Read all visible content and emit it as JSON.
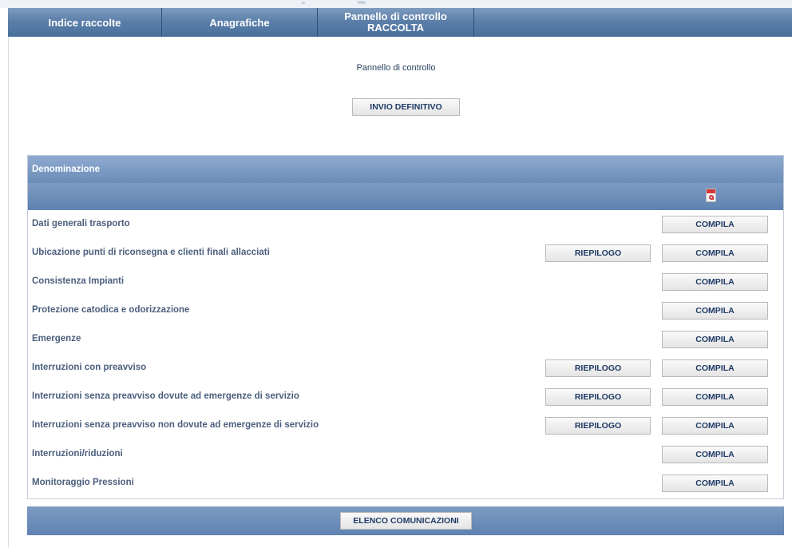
{
  "nav": {
    "items": [
      {
        "label": "Indice raccolte"
      },
      {
        "label": "Anagrafiche"
      },
      {
        "line1": "Pannello di controllo",
        "line2": "RACCOLTA"
      }
    ]
  },
  "header": {
    "title": "Pannello di controllo",
    "invio_label": "INVIO DEFINITIVO"
  },
  "table": {
    "column_header": "Denominazione",
    "pdf_icon": "pdf-icon",
    "riepilogo_label": "RIEPILOGO",
    "compila_label": "COMPILA",
    "rows": [
      {
        "label": "Dati generali trasporto",
        "riepilogo": false
      },
      {
        "label": "Ubicazione punti di riconsegna e clienti finali allacciati",
        "riepilogo": true
      },
      {
        "label": "Consistenza Impianti",
        "riepilogo": false
      },
      {
        "label": "Protezione catodica e odorizzazione",
        "riepilogo": false
      },
      {
        "label": "Emergenze",
        "riepilogo": false
      },
      {
        "label": "Interruzioni con preavviso",
        "riepilogo": true
      },
      {
        "label": "Interruzioni senza preavviso dovute ad emergenze di servizio",
        "riepilogo": true
      },
      {
        "label": "Interruzioni senza preavviso non dovute ad emergenze di servizio",
        "riepilogo": true
      },
      {
        "label": "Interruzioni/riduzioni",
        "riepilogo": false
      },
      {
        "label": "Monitoraggio Pressioni",
        "riepilogo": false
      }
    ]
  },
  "footer": {
    "elenco_label": "ELENCO COMUNICAZIONI"
  },
  "colors": {
    "nav_blue": "#5b7fa9",
    "panel_blue": "#6b8db9",
    "label_text": "#4b5f7d",
    "button_text": "#1f3b66"
  }
}
